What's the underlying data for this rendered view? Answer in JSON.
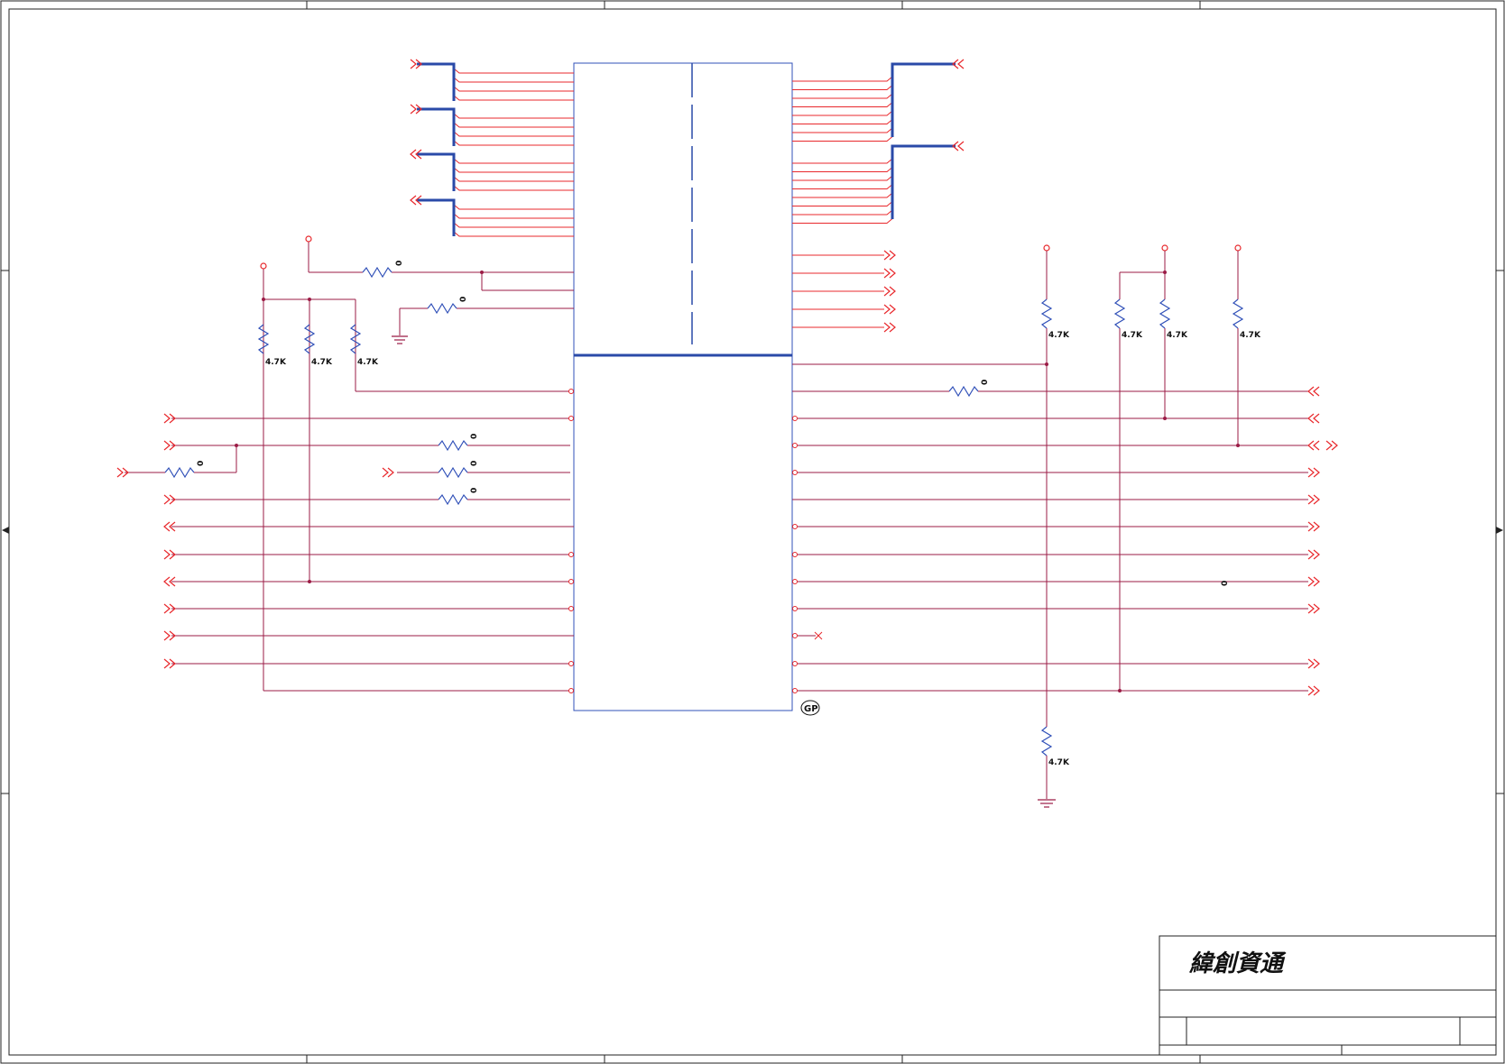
{
  "title_block": {
    "company": "緯創資通"
  },
  "labels": {
    "resistor_small": "0",
    "resistor_pullup": "4.7K",
    "chip_ref": "GP"
  },
  "colors": {
    "wire": "#e8282c",
    "net": "#9b1b45",
    "bus": "#2a4aa8",
    "component": "#3050b8",
    "frame": "#222222",
    "background": "#ffffff"
  },
  "icons": {
    "connector": "double-chevron-connector-icon",
    "ground": "ground-symbol-icon",
    "power": "power-rail-circle-icon",
    "resistor": "zigzag-resistor-icon"
  }
}
